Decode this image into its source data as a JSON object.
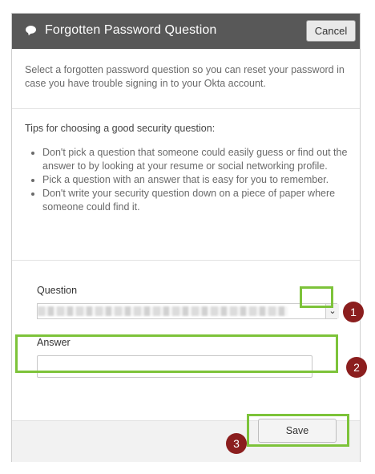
{
  "dialog": {
    "title": "Forgotten Password Question",
    "cancel_label": "Cancel",
    "intro": "Select a forgotten password question so you can reset your password in case you have trouble signing in to your Okta account.",
    "tips_title": "Tips for choosing a good security question:",
    "tips": [
      "Don't pick a question that someone could easily guess or find out the answer to by looking at your resume or social networking profile.",
      "Pick a question with an answer that is easy for you to remember.",
      "Don't write your security question down on a piece of paper where someone could find it."
    ],
    "question_label": "Question",
    "answer_label": "Answer",
    "answer_value": "",
    "save_label": "Save"
  },
  "steps": [
    "1",
    "2",
    "3"
  ],
  "colors": {
    "header": "#585858",
    "highlight": "#7dc33a",
    "step_badge": "#8b1e1e"
  },
  "icons": {
    "title": "chat-bubble-icon",
    "dropdown": "chevron-down-icon"
  }
}
